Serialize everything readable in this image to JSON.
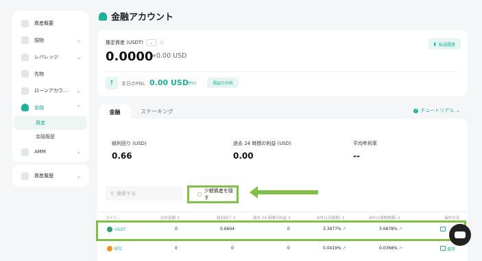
{
  "sidebar": {
    "items": [
      {
        "label": "資産概要",
        "chevron": ""
      },
      {
        "label": "現物",
        "chevron": "⌄"
      },
      {
        "label": "レバレッジ",
        "chevron": "⌄"
      },
      {
        "label": "先物",
        "chevron": ""
      },
      {
        "label": "ローンアカウ...",
        "chevron": "⌄"
      },
      {
        "label": "金融",
        "chevron": "⌃"
      }
    ],
    "sub_items": [
      {
        "label": "資産"
      },
      {
        "label": "金融履歴"
      }
    ],
    "amm": {
      "label": "AMM",
      "chevron": "⌄"
    },
    "history": {
      "label": "資産履歴",
      "chevron": "⌄"
    }
  },
  "header": {
    "title": "金融アカウント"
  },
  "summary": {
    "est_label": "推定資産 (USDT)",
    "amount": "0.0000",
    "approx": "≈0.00 USD",
    "transfer_btn": "転送履歴",
    "pnl_label": "本日のPNL",
    "pnl_value": "0.00 USD",
    "pnl_pct": "(0%)",
    "pnl_analysis": "損益の分析"
  },
  "tabs": {
    "finance": "金融",
    "staking": "ステーキング",
    "tutorial": "チュートリアル"
  },
  "stats": [
    {
      "label": "総利回り (USD)",
      "value": "0.66"
    },
    {
      "label": "過去 24 時間の利益 (USD)",
      "value": "0.00"
    },
    {
      "label": "平均年利率",
      "value": "--"
    }
  ],
  "search": {
    "placeholder": "検索する"
  },
  "hide_small": "少額資産を隠す",
  "table": {
    "headers": [
      "コイン...",
      "合計金額 ⇕",
      "総利回り ⇕",
      "過去 24 時間の利益 ⇕",
      "APY(1日換算) ⇕",
      "APY(1週間換算) ⇕",
      "操作方法"
    ],
    "rows": [
      {
        "coin": "USDT",
        "total": "0",
        "yield": "0.6604",
        "profit24": "0",
        "apy1d": "3.3977%",
        "apy1w": "3.6878%",
        "op": "運用"
      },
      {
        "coin": "BTC",
        "total": "0",
        "yield": "0",
        "profit24": "0",
        "apy1d": "0.0419%",
        "apy1w": "0.0368%",
        "op": "運用"
      }
    ]
  },
  "colors": {
    "accent": "#19b397",
    "annotation": "#7ec242"
  }
}
